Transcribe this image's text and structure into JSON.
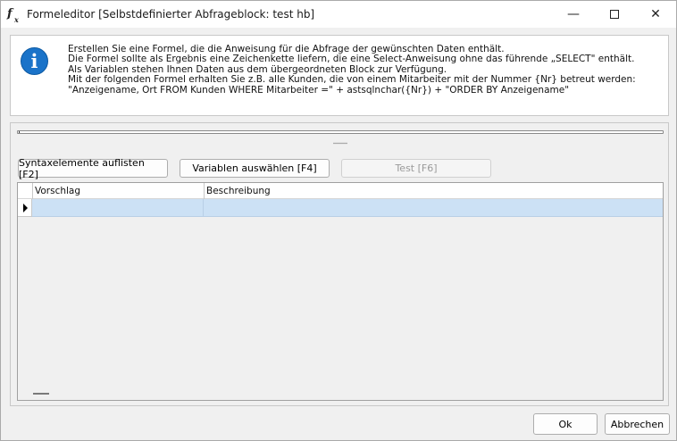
{
  "window": {
    "title": "Formeleditor [Selbstdefinierter Abfrageblock: test hb]",
    "app_icon": "fx-icon",
    "minimize_glyph": "—",
    "close_glyph": "✕"
  },
  "info": {
    "icon": "info-icon",
    "icon_glyph": "i",
    "lines": [
      "Erstellen Sie eine Formel, die die Anweisung für die Abfrage der gewünschten Daten enthält.",
      "Die Formel sollte als Ergebnis eine Zeichenkette liefern, die eine Select-Anweisung ohne das führende „SELECT\" enthält.",
      "Als Variablen stehen Ihnen Daten aus dem übergeordneten Block zur Verfügung.",
      "Mit der folgenden Formel erhalten Sie z.B. alle Kunden, die von einem Mitarbeiter mit der Nummer {Nr} betreut werden:",
      "\"Anzeigename, Ort FROM Kunden WHERE Mitarbeiter =\" + astsqlnchar({Nr}) + \"ORDER BY Anzeigename\""
    ]
  },
  "formula": {
    "value": ""
  },
  "toolbar": {
    "syntax_label": "Syntaxelemente auflisten [F2]",
    "variables_label": "Variablen auswählen [F4]",
    "test_label": "Test [F6]"
  },
  "grid": {
    "columns": [
      "Vorschlag",
      "Beschreibung"
    ],
    "rows": [
      {
        "vorschlag": "",
        "beschreibung": ""
      }
    ]
  },
  "footer": {
    "ok_label": "Ok",
    "cancel_label": "Abbrechen"
  },
  "colors": {
    "accent_info": "#1a73c9",
    "selection": "#cce1f5"
  }
}
